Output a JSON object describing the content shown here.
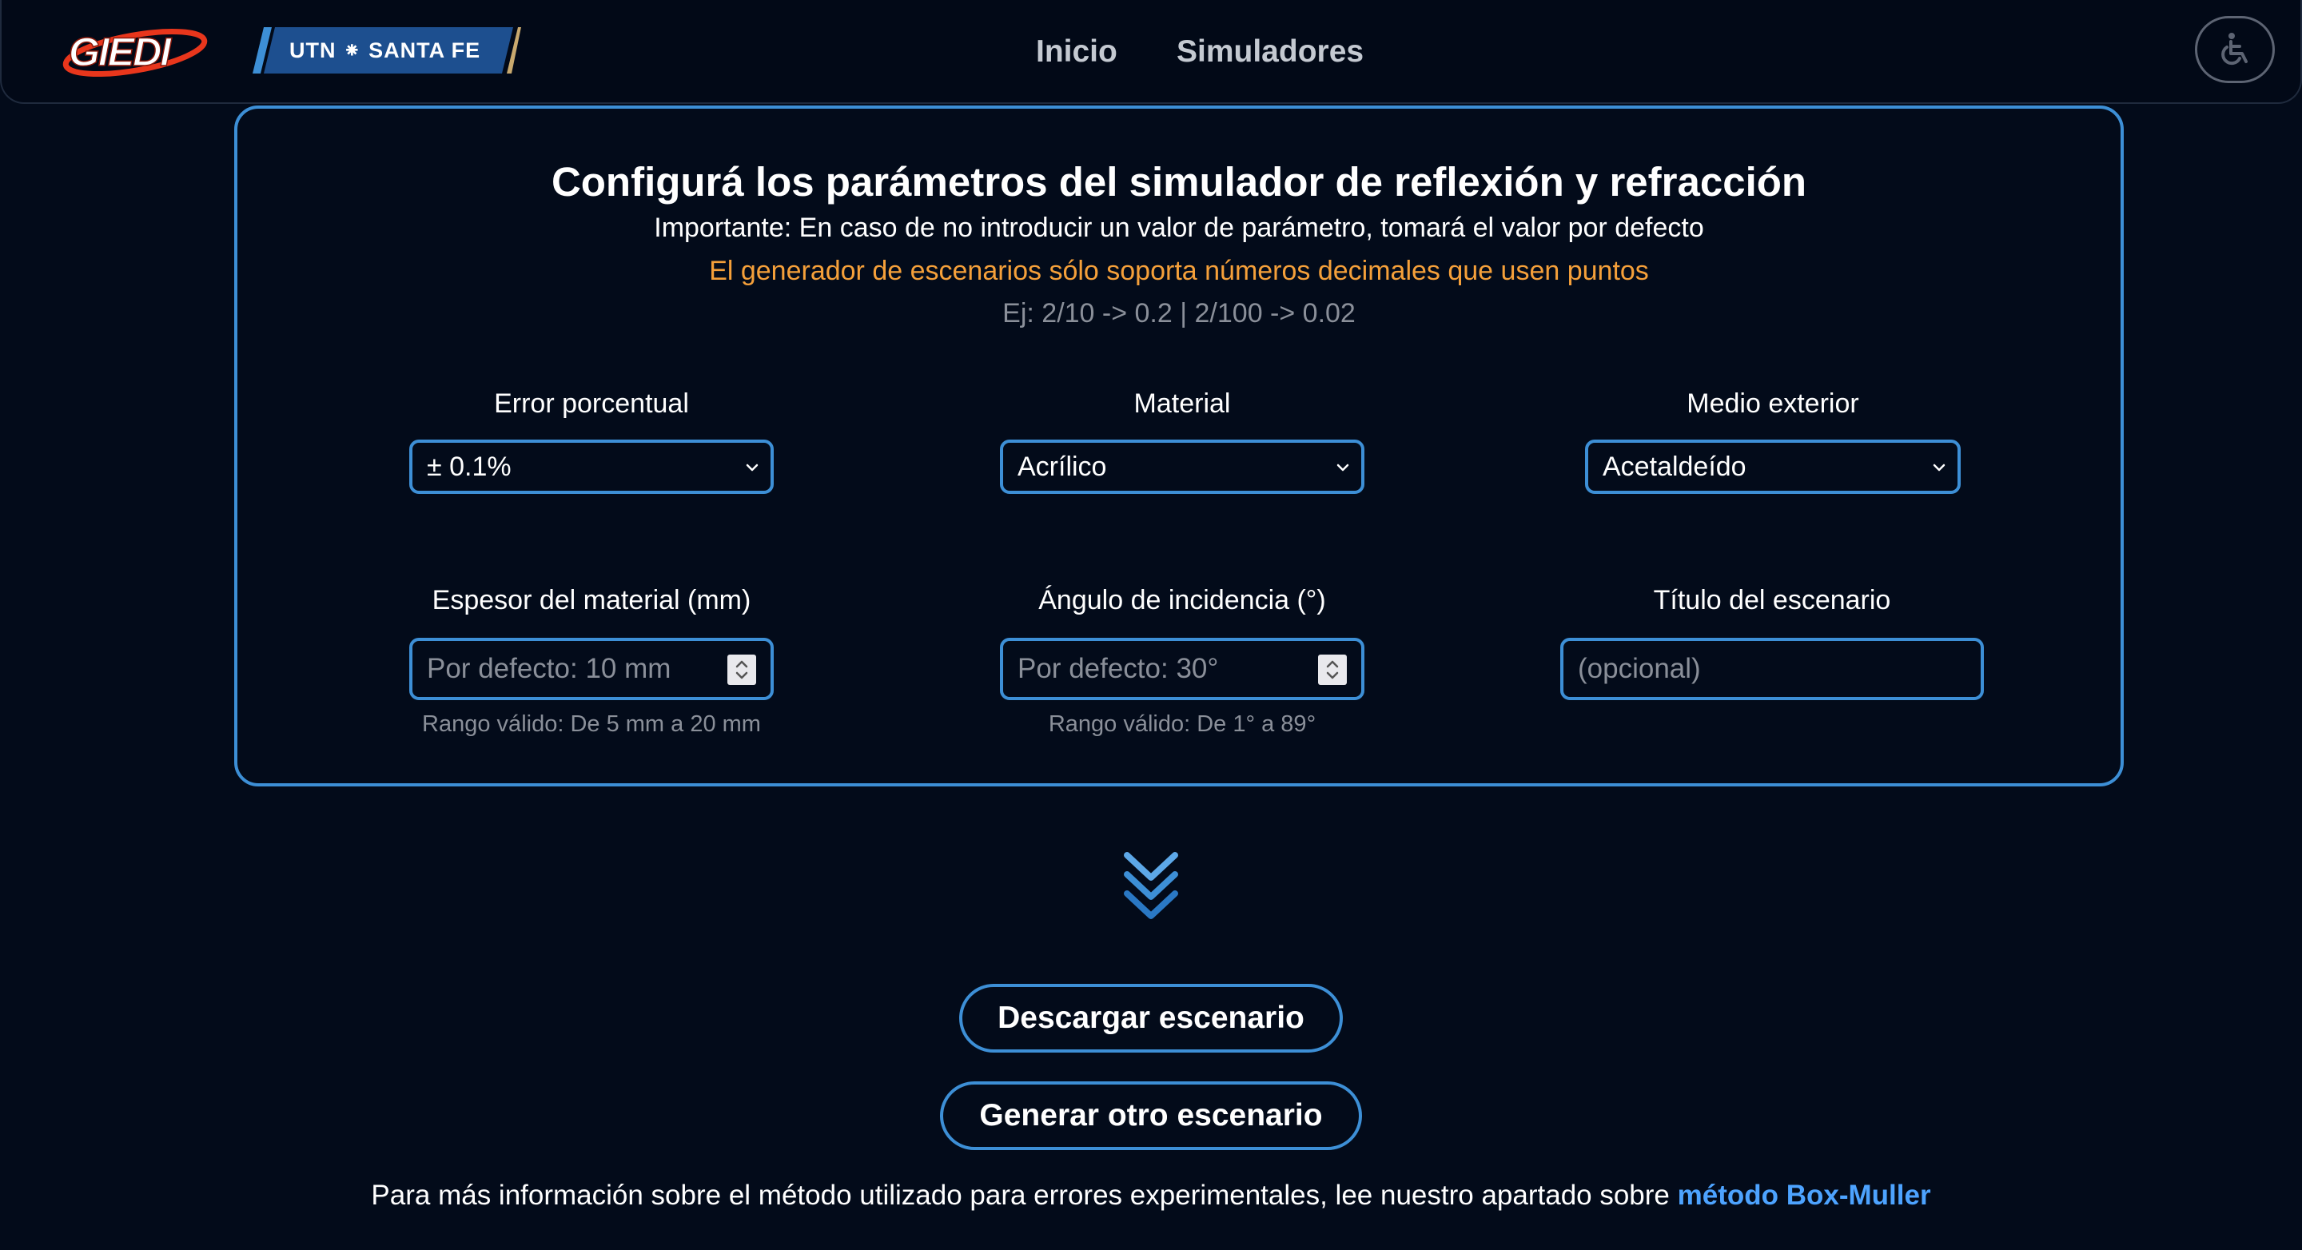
{
  "header": {
    "logo_text": "GIEDI",
    "institution_text": "UTN ⁕ SANTA FE",
    "nav": [
      {
        "label": "Inicio"
      },
      {
        "label": "Simuladores"
      }
    ],
    "accessibility_icon": "wheelchair-icon"
  },
  "config": {
    "title": "Configurá los parámetros del simulador de reflexión y refracción",
    "important_note": "Importante: En caso de no introducir un valor de parámetro, tomará el valor por defecto",
    "decimal_warning": "El generador de escenarios sólo soporta números decimales que usen puntos",
    "example": "Ej: 2/10 -> 0.2 | 2/100 -> 0.02",
    "fields": {
      "error": {
        "label": "Error porcentual",
        "value": "± 0.1%"
      },
      "material": {
        "label": "Material",
        "value": "Acrílico"
      },
      "medium": {
        "label": "Medio exterior",
        "value": "Acetaldeído"
      },
      "thickness": {
        "label": "Espesor del material (mm)",
        "placeholder": "Por defecto: 10 mm",
        "hint": "Rango válido: De 5 mm a 20 mm"
      },
      "angle": {
        "label": "Ángulo de incidencia (°)",
        "placeholder": "Por defecto: 30°",
        "hint": "Rango válido: De 1° a 89°"
      },
      "title": {
        "label": "Título del escenario",
        "placeholder": "(opcional)"
      }
    }
  },
  "actions": {
    "download_label": "Descargar escenario",
    "generate_label": "Generar otro escenario"
  },
  "footer": {
    "text": "Para más información sobre el método utilizado para errores experimentales, lee nuestro apartado sobre ",
    "link_text": "método Box-Muller"
  },
  "colors": {
    "background": "#030b1a",
    "accent": "#3d8fd6",
    "warning": "#f5a03a",
    "link": "#4da3ff",
    "muted": "#8a8f99"
  }
}
